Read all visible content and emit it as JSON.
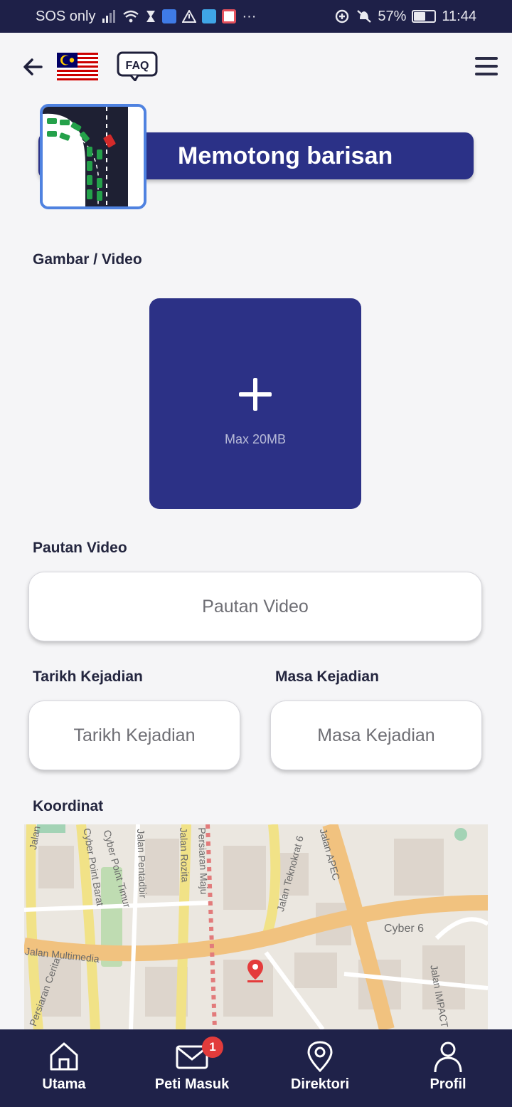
{
  "status_bar": {
    "carrier": "SOS only",
    "battery": "57%",
    "battery_level": 0.57,
    "time": "11:44",
    "more": "···"
  },
  "header": {
    "back_icon": "arrow-left-icon",
    "flag_icon": "malaysia-flag-icon",
    "faq_label": "FAQ",
    "menu_icon": "hamburger-menu-icon"
  },
  "category": {
    "title": "Memotong barisan",
    "thumbnail_icon": "cutting-queue-illustration"
  },
  "media": {
    "label": "Gambar / Video",
    "upload_hint": "Max 20MB",
    "upload_icon": "plus-icon"
  },
  "video_link": {
    "label": "Pautan Video",
    "placeholder": "Pautan Video"
  },
  "date": {
    "label": "Tarikh Kejadian",
    "placeholder": "Tarikh Kejadian"
  },
  "time": {
    "label": "Masa Kejadian",
    "placeholder": "Masa Kejadian"
  },
  "coordinates": {
    "label": "Koordinat",
    "map_labels": [
      "Jalan Ceria",
      "Cyber Point Barat",
      "Cyber Point Timur",
      "Jalan Pentadbir",
      "Jalan Rozita",
      "Jalan Teknokrat 6",
      "Jalan APEC",
      "Cyber 6",
      "Jalan Multimedia",
      "Persiaran Cerita",
      "Jalan IMPACT",
      "Persiaran Maju"
    ],
    "pin_icon": "map-pin-icon"
  },
  "bottom_nav": {
    "items": [
      {
        "label": "Utama",
        "icon": "home-icon"
      },
      {
        "label": "Peti Masuk",
        "icon": "mail-icon",
        "badge": "1"
      },
      {
        "label": "Direktori",
        "icon": "location-icon"
      },
      {
        "label": "Profil",
        "icon": "user-icon"
      }
    ]
  },
  "colors": {
    "primary": "#2b3187",
    "nav_background": "#1f2249",
    "badge": "#e23b3b",
    "thumb_border": "#4f82e0"
  }
}
